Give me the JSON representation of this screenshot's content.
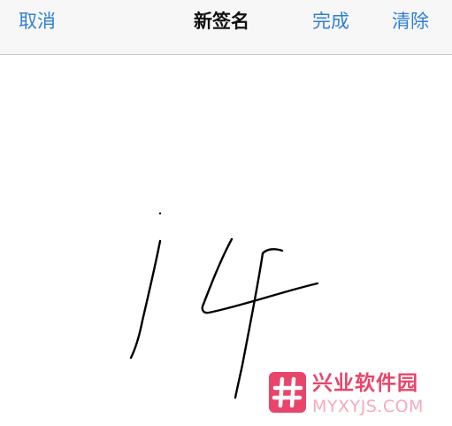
{
  "navbar": {
    "cancel_label": "取消",
    "title": "新签名",
    "done_label": "完成",
    "clear_label": "清除"
  },
  "signature": {
    "ink_color": "#000000"
  },
  "watermark": {
    "name": "兴业软件园",
    "domain": "MYXYJS.COM",
    "color": "#e8456b"
  },
  "colors": {
    "accent": "#2f7fd6",
    "navbar_bg": "#f7f7f7"
  }
}
